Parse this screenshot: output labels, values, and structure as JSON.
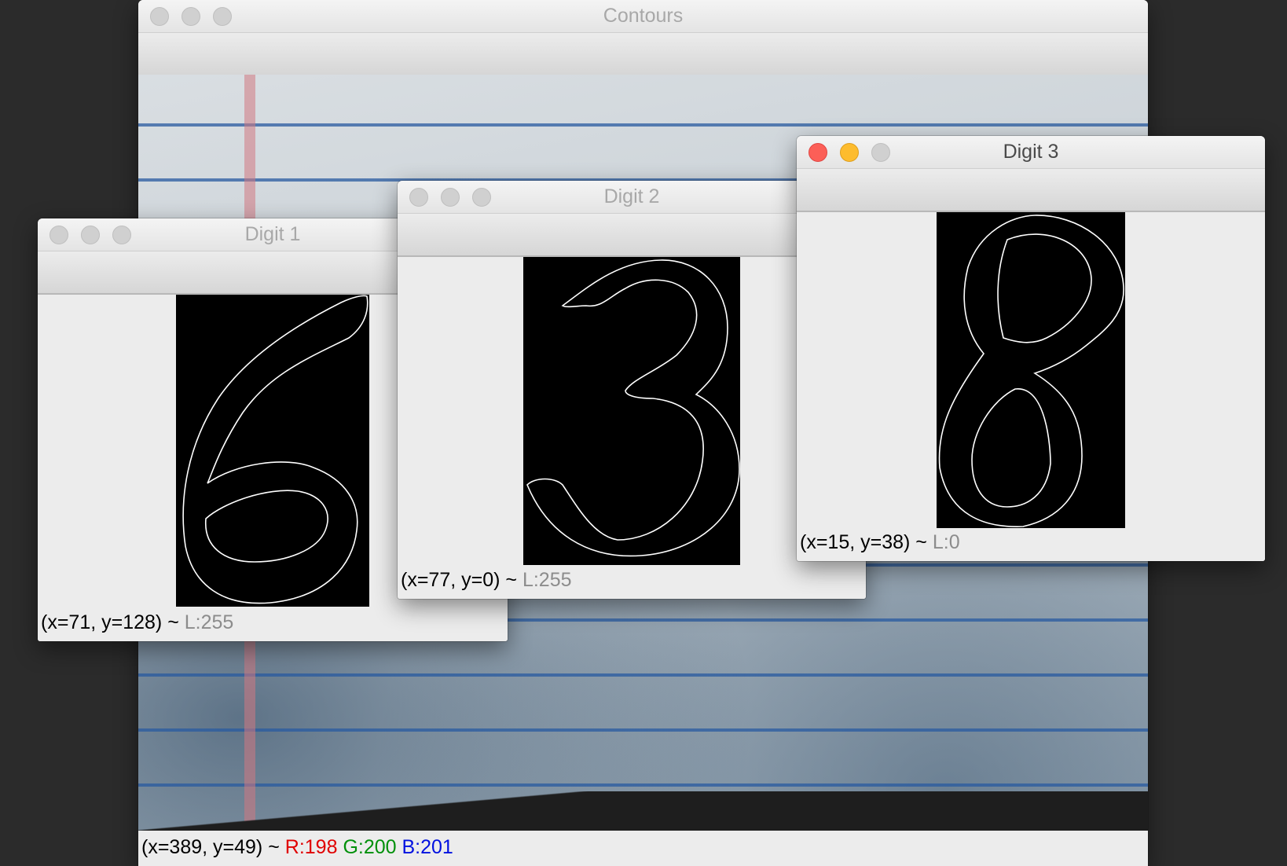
{
  "main_window": {
    "title": "Contours",
    "status": {
      "coords": "(x=389, y=49) ~ ",
      "r": "R:198",
      "g": "G:200",
      "b": "B:201"
    }
  },
  "digit1": {
    "title": "Digit 1",
    "status": {
      "coords": "(x=71, y=128) ~ ",
      "lum": "L:255"
    }
  },
  "digit2": {
    "title": "Digit 2",
    "status": {
      "coords": "(x=77, y=0) ~ ",
      "lum": "L:255"
    }
  },
  "digit3": {
    "title": "Digit 3",
    "status": {
      "coords": "(x=15, y=38) ~ ",
      "lum": "L:0"
    },
    "active": true
  },
  "traffic_lights": {
    "close": "#fc5f57",
    "minimize": "#fdbc2e",
    "inactive": "#d0d0d0"
  }
}
